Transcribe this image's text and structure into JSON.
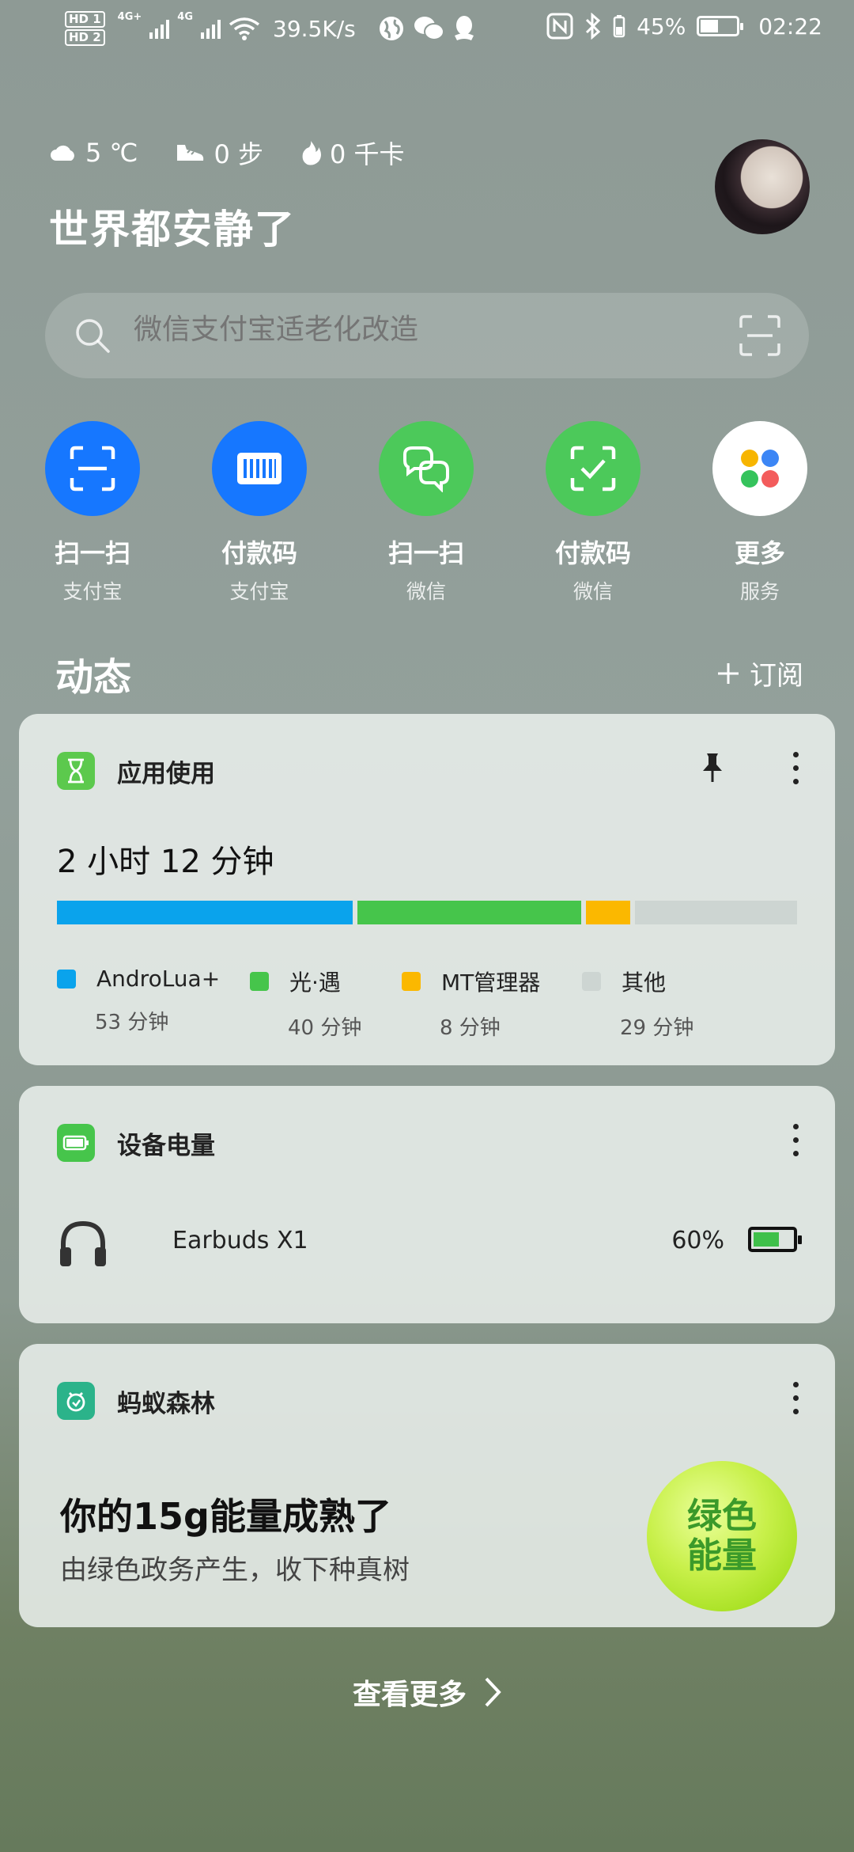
{
  "status_bar": {
    "hd1": "HD 1",
    "hd2": "HD 2",
    "net1": "4G+",
    "net2": "4G",
    "speed": "39.5K/s",
    "battery": "45%",
    "time": "02:22"
  },
  "header": {
    "weather": "5 ℃",
    "steps": "0 步",
    "calories": "0 千卡",
    "greeting": "世界都安静了"
  },
  "search": {
    "placeholder": "微信支付宝适老化改造"
  },
  "quick_actions": [
    {
      "label": "扫一扫",
      "sub": "支付宝",
      "color": "#1677ff",
      "icon": "scan-icon"
    },
    {
      "label": "付款码",
      "sub": "支付宝",
      "color": "#1677ff",
      "icon": "barcode-icon"
    },
    {
      "label": "扫一扫",
      "sub": "微信",
      "color": "#4cc95a",
      "icon": "wechat-icon"
    },
    {
      "label": "付款码",
      "sub": "微信",
      "color": "#4cc95a",
      "icon": "check-frame-icon"
    },
    {
      "label": "更多",
      "sub": "服务",
      "color": "#ffffff",
      "icon": "grid-icon"
    }
  ],
  "feed": {
    "title": "动态",
    "subscribe": "订阅"
  },
  "usage_card": {
    "title": "应用使用",
    "total": "2 小时 12 分钟",
    "segments": [
      {
        "name": "AndroLua+",
        "value": "53 分钟",
        "minutes": 53,
        "color": "#0aa3ec"
      },
      {
        "name": "光·遇",
        "value": "40 分钟",
        "minutes": 40,
        "color": "#46c54b"
      },
      {
        "name": "MT管理器",
        "value": "8 分钟",
        "minutes": 8,
        "color": "#fbb800"
      },
      {
        "name": "其他",
        "value": "29 分钟",
        "minutes": 29,
        "color": "#cdd5d2"
      }
    ]
  },
  "battery_card": {
    "title": "设备电量",
    "device": "Earbuds X1",
    "percent": "60%",
    "level": 0.6
  },
  "forest_card": {
    "title": "蚂蚁森林",
    "headline": "你的15g能量成熟了",
    "subtitle": "由绿色政务产生，收下种真树",
    "ball_line1": "绿色",
    "ball_line2": "能量"
  },
  "see_more": "查看更多"
}
